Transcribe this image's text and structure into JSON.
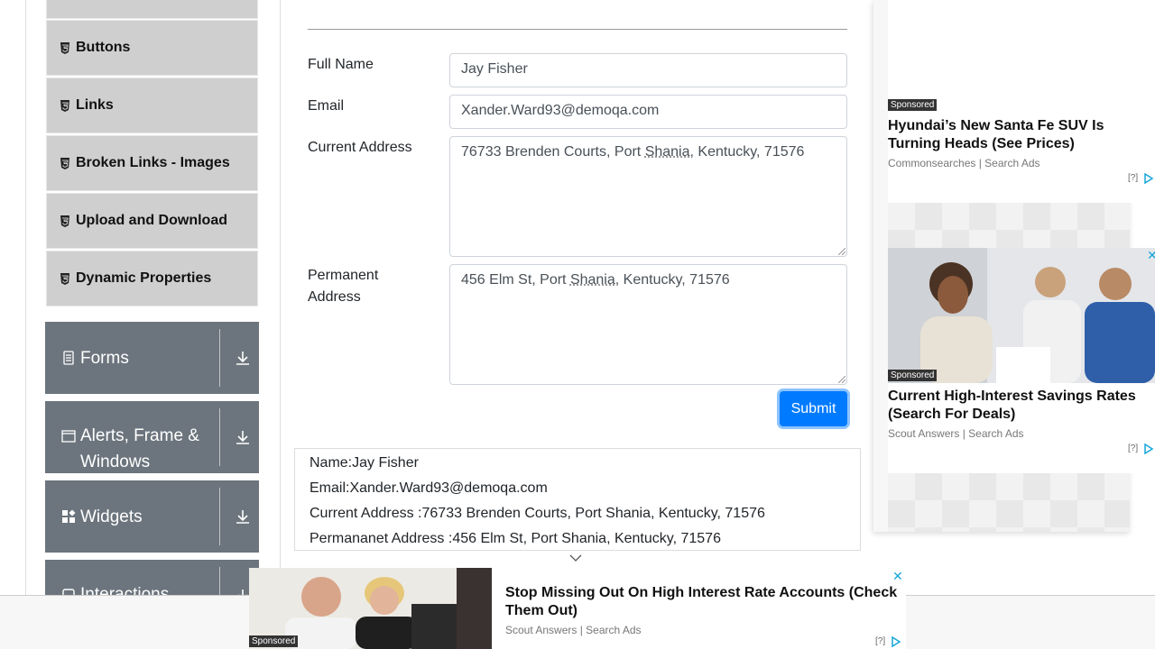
{
  "sidebar": {
    "elements_items": [
      {
        "label": "Buttons"
      },
      {
        "label": "Links"
      },
      {
        "label": "Broken Links - Images"
      },
      {
        "label": "Upload and Download"
      },
      {
        "label": "Dynamic Properties"
      }
    ],
    "groups": [
      {
        "title": "Forms"
      },
      {
        "title": "Alerts, Frame & Windows"
      },
      {
        "title": "Widgets"
      },
      {
        "title": "Interactions"
      }
    ]
  },
  "form": {
    "full_name_label": "Full Name",
    "full_name_value": "Jay Fisher",
    "email_label": "Email",
    "email_value": "Xander.Ward93@demoqa.com",
    "current_address_label": "Current Address",
    "current_address_pre": "76733 Brenden Courts, Port ",
    "current_address_mid": "Shania",
    "current_address_post": ", Kentucky, 71576",
    "permanent_address_label": "Permanent Address",
    "permanent_address_pre": "456 Elm St, Port ",
    "permanent_address_mid": "Shania",
    "permanent_address_post": ", Kentucky, 71576",
    "submit_label": "Submit"
  },
  "output": {
    "name": "Name:Jay Fisher",
    "email": "Email:Xander.Ward93@demoqa.com",
    "current_address": "Current Address :76733 Brenden Courts, Port Shania, Kentucky, 71576",
    "permanent_address": "Permananet Address :456 Elm St, Port Shania, Kentucky, 71576"
  },
  "ads": {
    "ad1": {
      "sponsored": "Sponsored",
      "title": "Hyundai’s New Santa Fe SUV Is Turning Heads (See Prices)",
      "source": "Commonsearches | Search Ads",
      "info": "[?]"
    },
    "ad2": {
      "sponsored": "Sponsored",
      "title": "Current High-Interest Savings Rates (Search For Deals)",
      "source": "Scout Answers | Search Ads",
      "info": "[?]"
    },
    "bottom": {
      "sponsored": "Sponsored",
      "title": "Stop Missing Out On High Interest Rate Accounts (Check Them Out)",
      "source": "Scout Answers | Search Ads",
      "info": "[?]"
    }
  },
  "colors": {
    "menu_item_bg": "#cfcfcf",
    "group_bg": "#6c757d",
    "submit_bg": "#007bff",
    "ad_close": "#16a6d9"
  }
}
